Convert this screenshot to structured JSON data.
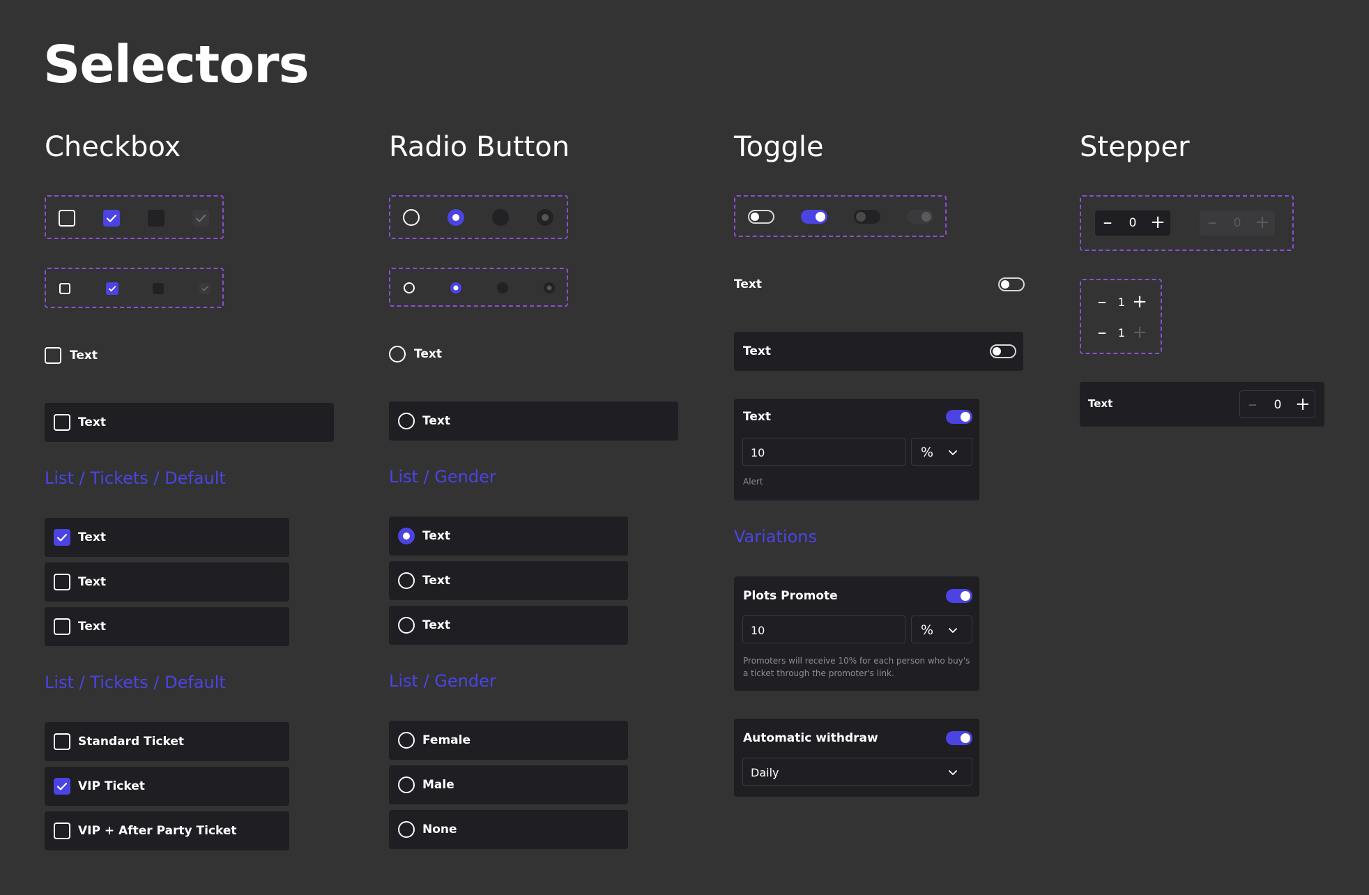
{
  "page": {
    "title": "Selectors"
  },
  "columns": {
    "checkbox": "Checkbox",
    "radio": "Radio Button",
    "toggle": "Toggle",
    "stepper": "Stepper"
  },
  "checkbox": {
    "single_label": "Text",
    "card_label": "Text",
    "list1_title": "List / Tickets / Default",
    "list1_items": [
      "Text",
      "Text",
      "Text"
    ],
    "list2_title": "List / Tickets / Default",
    "list2_items": [
      "Standard Ticket",
      "VIP Ticket",
      "VIP + After Party Ticket"
    ]
  },
  "radio": {
    "single_label": "Text",
    "card_label": "Text",
    "list1_title": "List / Gender",
    "list1_items": [
      "Text",
      "Text",
      "Text"
    ],
    "list2_title": "List / Gender",
    "list2_items": [
      "Female",
      "Male",
      "None"
    ]
  },
  "toggle": {
    "row_label": "Text",
    "card_label": "Text",
    "form_label": "Text",
    "form_value": "10",
    "form_unit": "%",
    "form_helper": "Alert",
    "variations_title": "Variations",
    "promote_label": "Plots Promote",
    "promote_value": "10",
    "promote_unit": "%",
    "promote_helper_line1": "Promoters will receive 10% for each person who buy's",
    "promote_helper_line2": "a ticket through the promoter's link.",
    "withdraw_label": "Automatic withdraw",
    "withdraw_value": "Daily"
  },
  "stepper": {
    "row1_values": [
      "0",
      "0"
    ],
    "row2_values": [
      "1",
      "1"
    ],
    "card_label": "Text",
    "card_value": "0"
  },
  "colors": {
    "accent": "#4b44e3",
    "background": "#333333",
    "card": "#1f1e22",
    "dashed_border": "#8a4fd6"
  }
}
